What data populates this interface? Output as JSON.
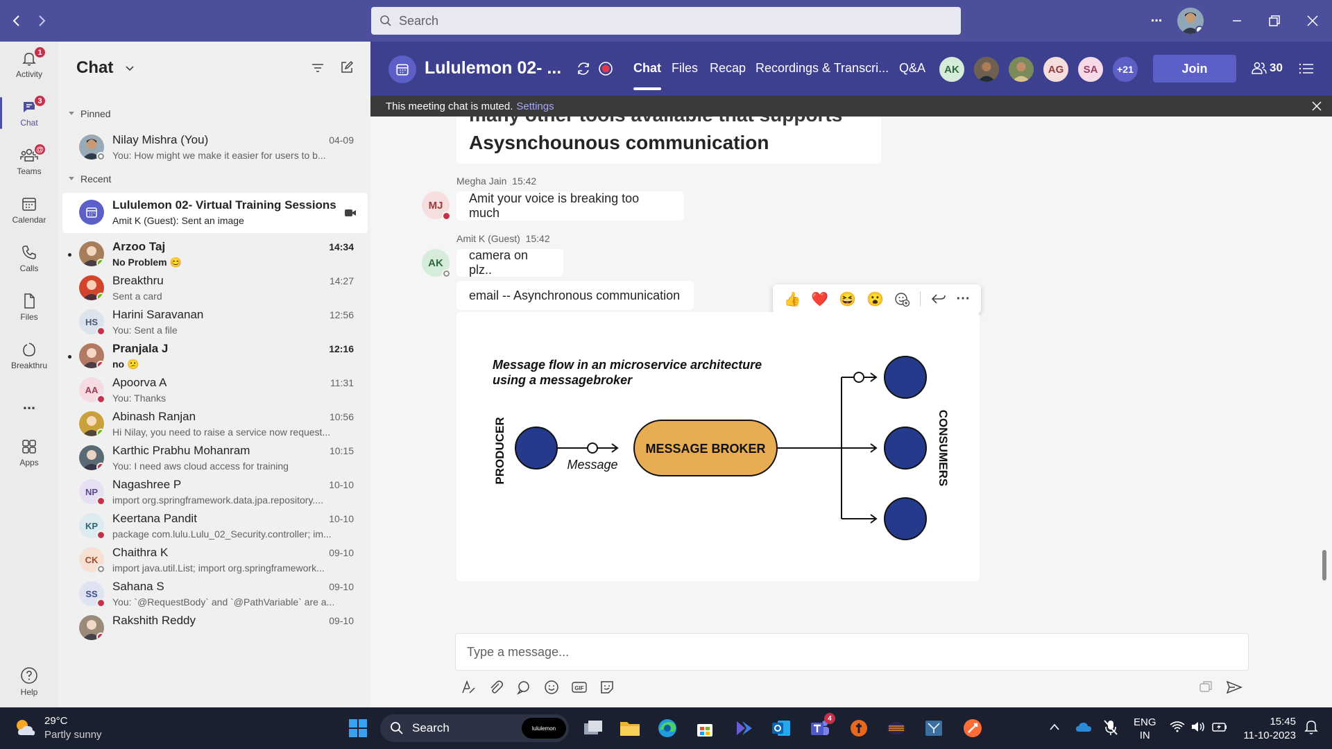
{
  "titlebar": {
    "search_placeholder": "Search",
    "more_label": "...",
    "window_controls": [
      "minimize-icon",
      "restore-icon",
      "close-icon"
    ]
  },
  "rail": {
    "items": [
      {
        "label": "Activity",
        "badge": "1",
        "icon": "bell-icon"
      },
      {
        "label": "Chat",
        "badge": "3",
        "icon": "chat-icon",
        "active": true
      },
      {
        "label": "Teams",
        "badge": "@",
        "icon": "teams-icon"
      },
      {
        "label": "Calendar",
        "icon": "calendar-icon"
      },
      {
        "label": "Calls",
        "icon": "phone-icon"
      },
      {
        "label": "Files",
        "icon": "file-icon"
      },
      {
        "label": "Breakthru",
        "icon": "breakthru-icon"
      },
      {
        "label": "...",
        "icon": "more-icon"
      },
      {
        "label": "Apps",
        "icon": "apps-icon"
      }
    ],
    "help_label": "Help"
  },
  "chatlist": {
    "title": "Chat",
    "pinned_label": "Pinned",
    "recent_label": "Recent",
    "pinned": [
      {
        "name": "Nilay Mishra (You)",
        "preview": "You: How might we make it easier for users to b...",
        "time": "04-09",
        "initials": "",
        "presence": "off",
        "avatar_color": "#c8a27a"
      }
    ],
    "recent": [
      {
        "name": "Lululemon 02- Virtual Training Sessions",
        "preview": "Amit K (Guest): Sent an image",
        "time": "",
        "initials": "",
        "selected": true,
        "meeting": true
      },
      {
        "name": "Arzoo Taj",
        "preview": "No Problem 😊",
        "time": "14:34",
        "initials": "",
        "presence": "avail",
        "bold": true,
        "avatar_color": "#a77e5a"
      },
      {
        "name": "Breakthru",
        "preview": "Sent a card",
        "time": "14:27",
        "initials": "",
        "presence": "avail",
        "avatar_color": "#d2452c"
      },
      {
        "name": "Harini Saravanan",
        "preview": "You: Sent a file",
        "time": "12:56",
        "initials": "HS",
        "presence": "busy",
        "avatar_color": "#dde3ec",
        "text_color": "#4a5a75"
      },
      {
        "name": "Pranjala J",
        "preview": "no 😕",
        "time": "12:16",
        "initials": "",
        "presence": "busy",
        "bold": true,
        "avatar_color": "#b37a63"
      },
      {
        "name": "Apoorva A",
        "preview": "You: Thanks",
        "time": "11:31",
        "initials": "AA",
        "presence": "busy",
        "avatar_color": "#f4dce2",
        "text_color": "#9a3b52"
      },
      {
        "name": "Abinash Ranjan",
        "preview": "Hi Nilay, you need to raise a service now request...",
        "time": "10:56",
        "initials": "",
        "presence": "avail",
        "avatar_color": "#c9a13a"
      },
      {
        "name": "Karthic Prabhu Mohanram",
        "preview": "You: I need aws cloud access for training",
        "time": "10:15",
        "initials": "",
        "presence": "busy",
        "avatar_color": "#5a6a74"
      },
      {
        "name": "Nagashree P",
        "preview": "import org.springframework.data.jpa.repository....",
        "time": "10-10",
        "initials": "NP",
        "presence": "busy",
        "avatar_color": "#e6e0f2",
        "text_color": "#5b4a8a"
      },
      {
        "name": "Keertana Pandit",
        "preview": "package com.lulu.Lulu_02_Security.controller; im...",
        "time": "10-10",
        "initials": "KP",
        "presence": "busy",
        "avatar_color": "#dcebf0",
        "text_color": "#2f6476"
      },
      {
        "name": "Chaithra K",
        "preview": "import java.util.List; import org.springframework...",
        "time": "09-10",
        "initials": "CK",
        "presence": "off",
        "avatar_color": "#f6e0d4",
        "text_color": "#9a4d2a"
      },
      {
        "name": "Sahana S",
        "preview": "You: `@RequestBody` and `@PathVariable` are a...",
        "time": "09-10",
        "initials": "SS",
        "presence": "busy",
        "avatar_color": "#e0e4f2",
        "text_color": "#3f4f8a"
      },
      {
        "name": "Rakshith Reddy",
        "preview": "",
        "time": "09-10",
        "initials": "",
        "presence": "busy",
        "avatar_color": "#9a8a7a"
      }
    ]
  },
  "meeting": {
    "title": "Lululemon 02- ...",
    "tabs": [
      "Chat",
      "Files",
      "Recap",
      "Recordings & Transcri...",
      "Q&A"
    ],
    "participants": [
      {
        "initials": "AK",
        "bg": "#d4ecd9",
        "fg": "#2e6b3a"
      },
      {
        "initials": "",
        "bg": "#6f6152",
        "fg": "#fff"
      },
      {
        "initials": "",
        "bg": "#7b8a5a",
        "fg": "#fff"
      },
      {
        "initials": "AG",
        "bg": "#f6dede",
        "fg": "#9a3b3b"
      },
      {
        "initials": "SA",
        "bg": "#f6dbe6",
        "fg": "#9a3b62"
      }
    ],
    "more_participants": "+21",
    "join_label": "Join",
    "participant_count": "30",
    "muted_notice": "This meeting chat is muted.",
    "settings_link": "Settings"
  },
  "messages": {
    "partial_heading": "many other tools available that supports",
    "heading": "Asysnchounous communication",
    "m1_sender": "Megha Jain",
    "m1_time": "15:42",
    "m1_initials": "MJ",
    "m1_text": "Amit your voice is breaking too much",
    "m2_sender": "Amit K (Guest)",
    "m2_time": "15:42",
    "m2_initials": "AK",
    "m2_text": "camera on plz..",
    "m3_text": "email --  Asynchronous communication",
    "reactions": [
      "👍",
      "❤️",
      "😆",
      "😮",
      "add-reaction-icon",
      "reply-icon",
      "more-icon"
    ]
  },
  "diagram": {
    "title_line1": "Message flow in an microservice architecture",
    "title_line2": "using a messagebroker",
    "producer_label": "PRODUCER",
    "message_label": "Message",
    "broker_label": "MESSAGE BROKER",
    "consumers_label": "CONSUMERS",
    "node_color": "#253a8a",
    "broker_color": "#e8ac52"
  },
  "compose": {
    "placeholder": "Type a message...",
    "tools": [
      "format-icon",
      "attach-icon",
      "loop-icon",
      "emoji-icon",
      "gif-icon",
      "sticker-icon"
    ]
  },
  "taskbar": {
    "weather_temp": "29°C",
    "weather_desc": "Partly sunny",
    "search_label": "Search",
    "search_badge": "lululemon",
    "lang_line1": "ENG",
    "lang_line2": "IN",
    "time": "15:45",
    "date": "11-10-2023",
    "teams_badge": "4"
  }
}
